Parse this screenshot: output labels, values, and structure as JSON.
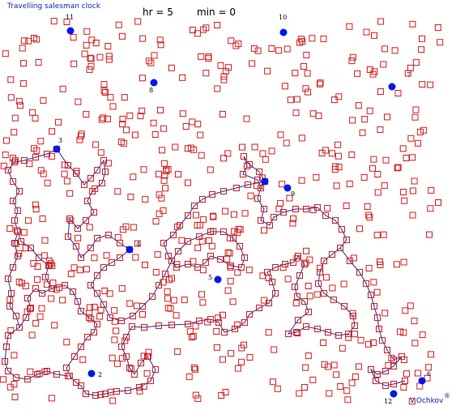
{
  "header": {
    "title": "Travelling salesman clock",
    "hr": "hr = 5",
    "min": "min = 0"
  },
  "footer": {
    "author": "V.Ochkov",
    "reg": "®"
  },
  "colors": {
    "route": "#2a2aa6",
    "city": "#d02020",
    "dial": "#0018e8",
    "label": "#000000"
  },
  "dial_labels": [
    "1",
    "2",
    "3",
    "4",
    "5",
    "6",
    "7",
    "8",
    "9",
    "10",
    "11",
    "12"
  ]
}
